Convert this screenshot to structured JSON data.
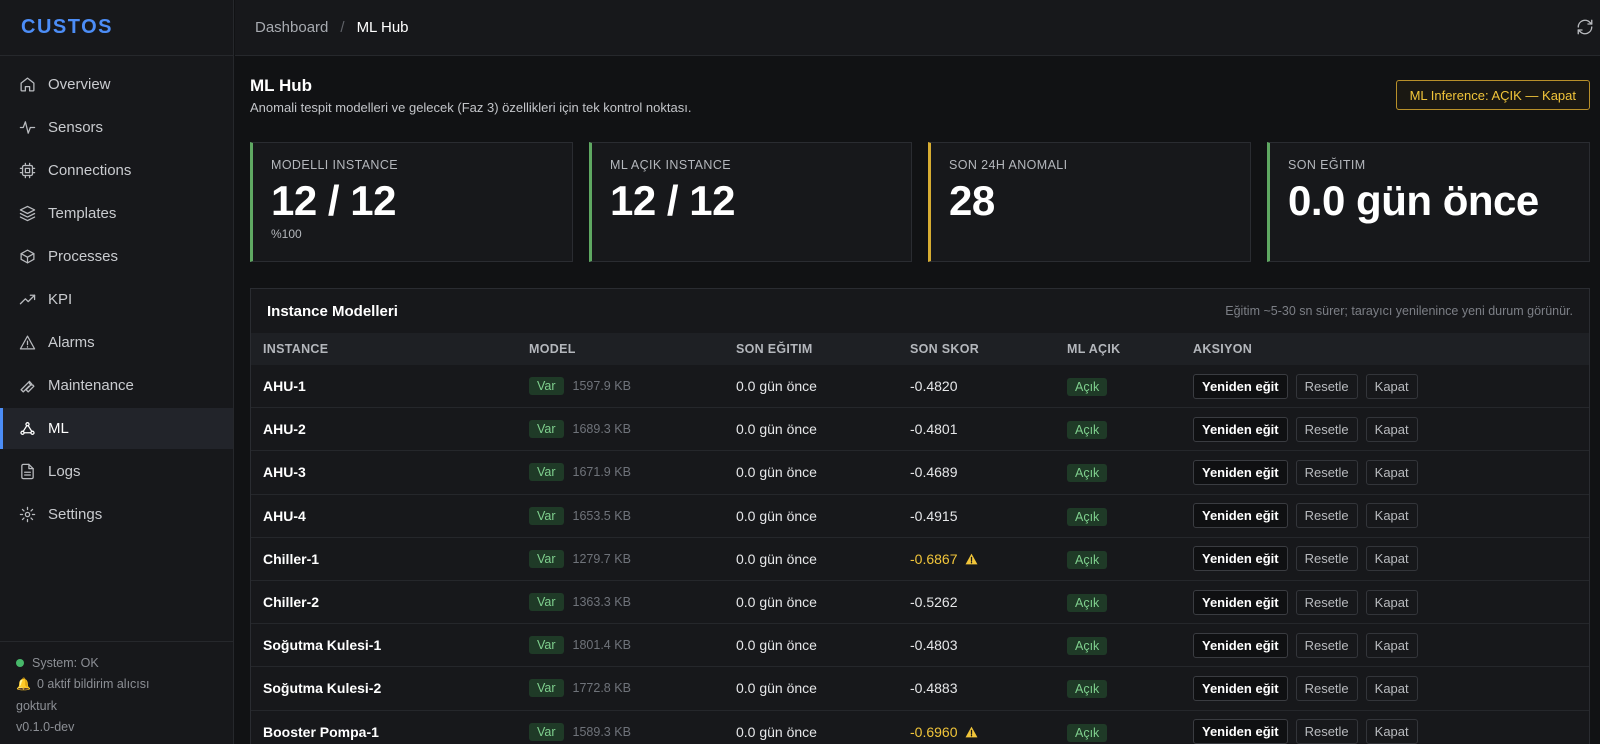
{
  "brand": "CUSTOS",
  "nav": [
    {
      "label": "Overview",
      "icon": "home-icon"
    },
    {
      "label": "Sensors",
      "icon": "activity-icon"
    },
    {
      "label": "Connections",
      "icon": "chip-icon"
    },
    {
      "label": "Templates",
      "icon": "layers-icon"
    },
    {
      "label": "Processes",
      "icon": "box-icon"
    },
    {
      "label": "KPI",
      "icon": "trending-icon"
    },
    {
      "label": "Alarms",
      "icon": "alert-icon"
    },
    {
      "label": "Maintenance",
      "icon": "wrench-icon"
    },
    {
      "label": "ML",
      "icon": "network-icon",
      "active": true
    },
    {
      "label": "Logs",
      "icon": "file-icon"
    },
    {
      "label": "Settings",
      "icon": "gear-icon"
    }
  ],
  "footer": {
    "status": "System: OK",
    "notify": "0 aktif bildirim alıcısı",
    "user": "gokturk",
    "version": "v0.1.0-dev"
  },
  "breadcrumb": {
    "parent": "Dashboard",
    "sep": "/",
    "current": "ML Hub"
  },
  "page": {
    "title": "ML Hub",
    "subtitle": "Anomali tespit modelleri ve gelecek (Faz 3) özellikleri için tek kontrol noktası.",
    "toggle": "ML Inference: AÇIK — Kapat"
  },
  "cards": [
    {
      "label": "MODELLI INSTANCE",
      "value": "12 / 12",
      "sub": "%100",
      "color": "#5fa862"
    },
    {
      "label": "ML AÇIK INSTANCE",
      "value": "12 / 12",
      "sub": "",
      "color": "#5fa862"
    },
    {
      "label": "SON 24H ANOMALI",
      "value": "28",
      "sub": "",
      "color": "#d6ac32"
    },
    {
      "label": "SON EĞITIM",
      "value": "0.0 gün önce",
      "sub": "",
      "color": "#5fa862"
    }
  ],
  "table": {
    "title": "Instance Modelleri",
    "note": "Eğitim ~5-30 sn sürer; tarayıcı yenilenince yeni durum görünür.",
    "headers": [
      "INSTANCE",
      "MODEL",
      "SON EĞITIM",
      "SON SKOR",
      "ML AÇIK",
      "AKSIYON"
    ],
    "actions": {
      "retrain": "Yeniden eğit",
      "reset": "Resetle",
      "close": "Kapat"
    },
    "rows": [
      {
        "instance": "AHU-1",
        "model": "Var",
        "size": "1597.9 KB",
        "trained": "0.0 gün önce",
        "score": "-0.4820",
        "warn": false,
        "ml": "Açık"
      },
      {
        "instance": "AHU-2",
        "model": "Var",
        "size": "1689.3 KB",
        "trained": "0.0 gün önce",
        "score": "-0.4801",
        "warn": false,
        "ml": "Açık"
      },
      {
        "instance": "AHU-3",
        "model": "Var",
        "size": "1671.9 KB",
        "trained": "0.0 gün önce",
        "score": "-0.4689",
        "warn": false,
        "ml": "Açık"
      },
      {
        "instance": "AHU-4",
        "model": "Var",
        "size": "1653.5 KB",
        "trained": "0.0 gün önce",
        "score": "-0.4915",
        "warn": false,
        "ml": "Açık"
      },
      {
        "instance": "Chiller-1",
        "model": "Var",
        "size": "1279.7 KB",
        "trained": "0.0 gün önce",
        "score": "-0.6867",
        "warn": true,
        "ml": "Açık"
      },
      {
        "instance": "Chiller-2",
        "model": "Var",
        "size": "1363.3 KB",
        "trained": "0.0 gün önce",
        "score": "-0.5262",
        "warn": false,
        "ml": "Açık"
      },
      {
        "instance": "Soğutma Kulesi-1",
        "model": "Var",
        "size": "1801.4 KB",
        "trained": "0.0 gün önce",
        "score": "-0.4803",
        "warn": false,
        "ml": "Açık"
      },
      {
        "instance": "Soğutma Kulesi-2",
        "model": "Var",
        "size": "1772.8 KB",
        "trained": "0.0 gün önce",
        "score": "-0.4883",
        "warn": false,
        "ml": "Açık"
      },
      {
        "instance": "Booster Pompa-1",
        "model": "Var",
        "size": "1589.3 KB",
        "trained": "0.0 gün önce",
        "score": "-0.6960",
        "warn": true,
        "ml": "Açık"
      }
    ]
  }
}
